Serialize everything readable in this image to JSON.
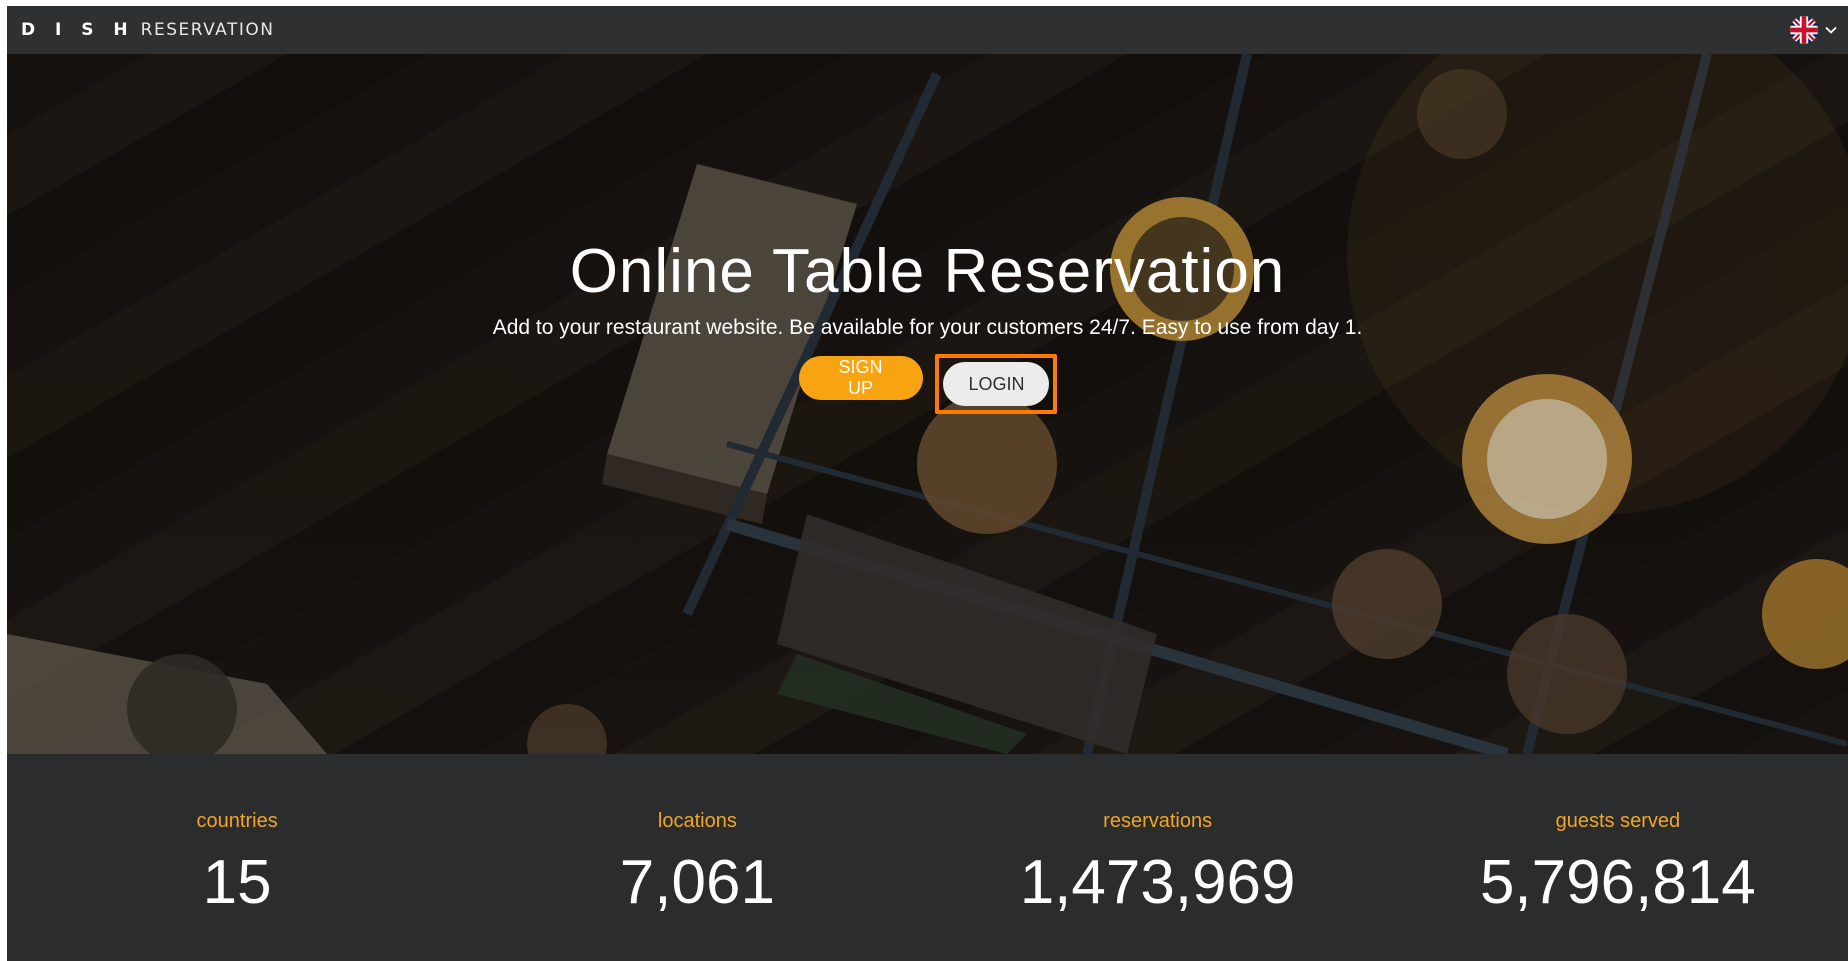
{
  "header": {
    "brand_dish": "D I S H",
    "brand_reservation": "RESERVATION",
    "language_icon": "uk-flag-icon",
    "dropdown_icon": "chevron-down-icon"
  },
  "hero": {
    "title": "Online Table Reservation",
    "subtitle": "Add to your restaurant website. Be available for your customers 24/7. Easy to use from day 1.",
    "signup_label": "SIGN UP",
    "login_label": "LOGIN"
  },
  "stats": [
    {
      "label": "countries",
      "value": "15"
    },
    {
      "label": "locations",
      "value": "7,061"
    },
    {
      "label": "reservations",
      "value": "1,473,969"
    },
    {
      "label": "guests served",
      "value": "5,796,814"
    }
  ],
  "colors": {
    "accent": "#f8a312",
    "highlight": "#ff7a00",
    "stat_label": "#f3a523",
    "background": "#2b2c2d"
  }
}
